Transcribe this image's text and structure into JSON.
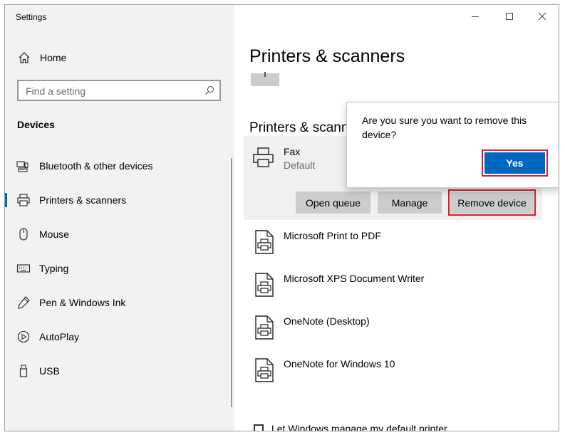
{
  "window": {
    "app_title": "Settings",
    "controls": {
      "minimize_icon": "minimize-icon",
      "maximize_icon": "maximize-icon",
      "close_icon": "close-icon"
    }
  },
  "sidebar": {
    "home_label": "Home",
    "search_placeholder": "Find a setting",
    "section_title": "Devices",
    "items": [
      {
        "label": "Bluetooth & other devices",
        "icon": "bluetooth-devices-icon",
        "selected": false
      },
      {
        "label": "Printers & scanners",
        "icon": "printer-icon",
        "selected": true
      },
      {
        "label": "Mouse",
        "icon": "mouse-icon",
        "selected": false
      },
      {
        "label": "Typing",
        "icon": "keyboard-icon",
        "selected": false
      },
      {
        "label": "Pen & Windows Ink",
        "icon": "pen-icon",
        "selected": false
      },
      {
        "label": "AutoPlay",
        "icon": "autoplay-icon",
        "selected": false
      },
      {
        "label": "USB",
        "icon": "usb-icon",
        "selected": false
      }
    ]
  },
  "main": {
    "page_title": "Printers & scanners",
    "add_button_icon": "plus-icon",
    "subsection_title": "Printers & scanners",
    "selected_printer": {
      "name": "Fax",
      "status": "Default",
      "buttons": {
        "open_queue": "Open queue",
        "manage": "Manage",
        "remove": "Remove device"
      }
    },
    "printers": [
      {
        "name": "Microsoft Print to PDF"
      },
      {
        "name": "Microsoft XPS Document Writer"
      },
      {
        "name": "OneNote (Desktop)"
      },
      {
        "name": "OneNote for Windows 10"
      }
    ],
    "default_printer_checkbox": "Let Windows manage my default printer"
  },
  "dialog": {
    "message": "Are you sure you want to remove this device?",
    "yes_label": "Yes"
  },
  "colors": {
    "accent": "#0067c0",
    "highlight_border": "#d81e2c",
    "sidebar_bg": "#f2f2f2",
    "button_bg": "#cccccc"
  }
}
